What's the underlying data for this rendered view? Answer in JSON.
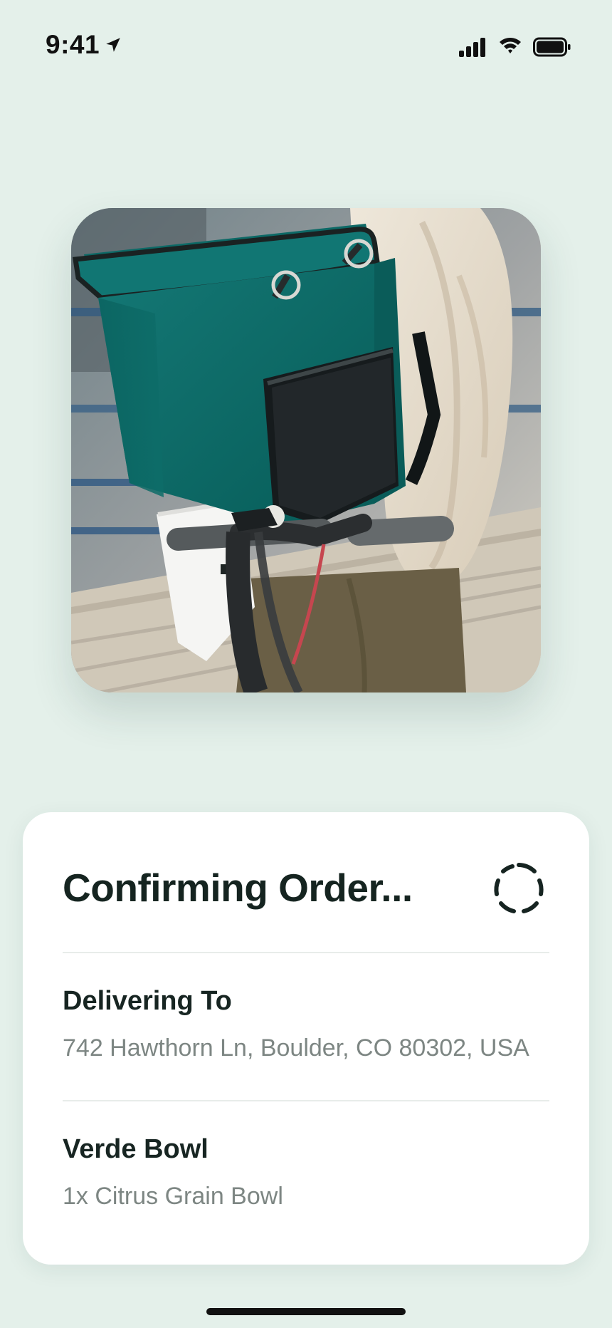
{
  "status_bar": {
    "time": "9:41",
    "icons": [
      "location-arrow-icon",
      "signal-icon",
      "wifi-icon",
      "battery-icon"
    ]
  },
  "hero": {
    "image_subject": "delivery courier with teal insulated backpack and electric scooter"
  },
  "order": {
    "title": "Confirming Order...",
    "spinner_icon": "loading-spinner-icon",
    "delivery": {
      "heading": "Delivering To",
      "address": "742 Hawthorn Ln, Boulder, CO 80302, USA"
    },
    "restaurant": {
      "heading": "Verde Bowl",
      "items": "1x Citrus Grain Bowl"
    }
  },
  "colors": {
    "background": "#e4f0ea",
    "card": "#ffffff",
    "heading_text": "#152420",
    "secondary_text": "#7d8683",
    "teal_bag": "#0f706c"
  }
}
